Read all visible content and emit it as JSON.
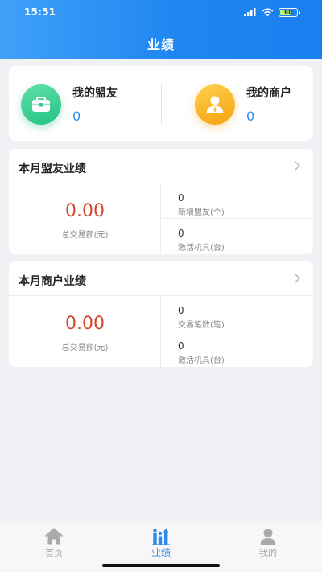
{
  "status_bar": {
    "time": "15:51",
    "battery": "68"
  },
  "header": {
    "title": "业绩"
  },
  "summary": {
    "friends": {
      "label": "我的盟友",
      "value": "0"
    },
    "merchants": {
      "label": "我的商户",
      "value": "0"
    }
  },
  "friend_performance": {
    "title": "本月盟友业绩",
    "amount": "0.00",
    "amount_label": "总交易额(元)",
    "stats": [
      {
        "value": "0",
        "label": "新增盟友(个)"
      },
      {
        "value": "0",
        "label": "激活机具(台)"
      }
    ]
  },
  "merchant_performance": {
    "title": "本月商户业绩",
    "amount": "0.00",
    "amount_label": "总交易额(元)",
    "stats": [
      {
        "value": "0",
        "label": "交易笔数(笔)"
      },
      {
        "value": "0",
        "label": "激活机具(台)"
      }
    ]
  },
  "tabbar": {
    "items": [
      {
        "label": "首页",
        "icon": "home-icon"
      },
      {
        "label": "业绩",
        "icon": "performance-chart-icon"
      },
      {
        "label": "我的",
        "icon": "user-icon"
      }
    ],
    "active_color": "#2a8ae9",
    "inactive_color": "#a6a6a6"
  },
  "colors": {
    "header_blue": "#1f86f1",
    "amount_red": "#d2472a",
    "value_blue": "#2b8de8",
    "friend_green": "#23c283",
    "merchant_orange": "#f5a210"
  }
}
